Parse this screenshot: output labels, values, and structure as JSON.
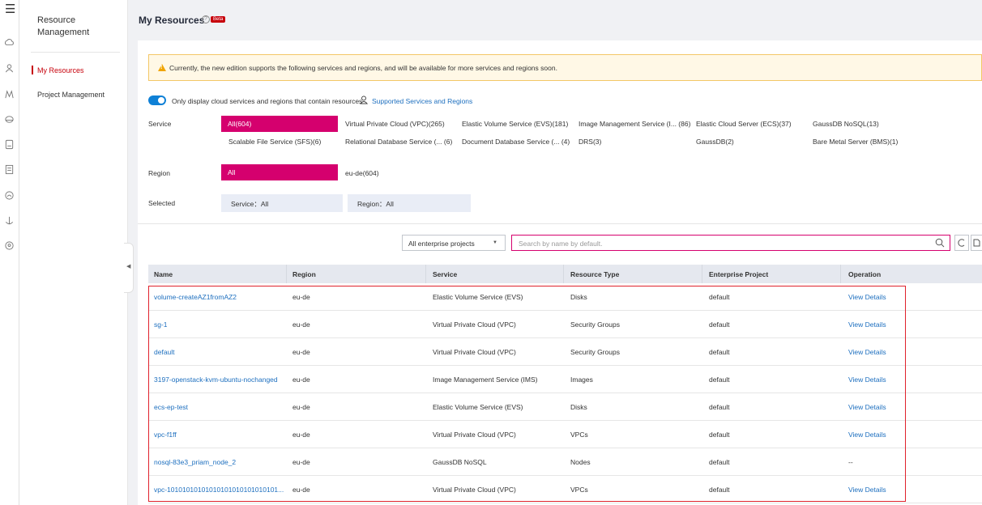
{
  "rail": {
    "icons": [
      "menu-icon",
      "cloud-icon",
      "user-group-icon",
      "network-icon",
      "database-icon",
      "storage-icon",
      "document-icon",
      "cloud-outline-icon",
      "anchor-icon",
      "pin-icon"
    ]
  },
  "sidebar": {
    "title": "Resource Management",
    "items": [
      {
        "label": "My Resources",
        "active": true
      },
      {
        "label": "Project Management",
        "active": false
      }
    ]
  },
  "header": {
    "title": "My Resources",
    "badge": "Beta"
  },
  "notice": {
    "text": "Currently, the new edition supports the following services and regions, and will be available for more services and regions soon."
  },
  "toggle": {
    "label": "Only display cloud services and regions that contain resources",
    "on": true,
    "link": "Supported Services and Regions"
  },
  "filters": {
    "service_label": "Service",
    "region_label": "Region",
    "selected_label": "Selected",
    "service_all": "All(604)",
    "service_row1": [
      "Virtual Private Cloud (VPC)(265)",
      "Elastic Volume Service (EVS)(181)",
      "Image Management Service (I... (86)",
      "Elastic Cloud Server (ECS)(37)",
      "GaussDB NoSQL(13)"
    ],
    "service_row2": [
      "Scalable File Service (SFS)(6)",
      "Relational Database Service (... (6)",
      "Document Database Service (... (4)",
      "DRS(3)",
      "GaussDB(2)",
      "Bare Metal Server (BMS)(1)"
    ],
    "region_all": "All",
    "region_options": [
      "eu-de(604)"
    ],
    "selected_service": "Service：All",
    "selected_region": "Region：All"
  },
  "toolbar": {
    "enterprise_select": "All enterprise projects",
    "search_placeholder": "Search by name by default."
  },
  "table": {
    "headers": [
      "Name",
      "Region",
      "Service",
      "Resource Type",
      "Enterprise Project",
      "Operation"
    ],
    "rows": [
      {
        "name": "volume-createAZ1fromAZ2",
        "region": "eu-de",
        "service": "Elastic Volume Service (EVS)",
        "type": "Disks",
        "project": "default",
        "op": "View Details"
      },
      {
        "name": "sg-1",
        "region": "eu-de",
        "service": "Virtual Private Cloud (VPC)",
        "type": "Security Groups",
        "project": "default",
        "op": "View Details"
      },
      {
        "name": "default",
        "region": "eu-de",
        "service": "Virtual Private Cloud (VPC)",
        "type": "Security Groups",
        "project": "default",
        "op": "View Details"
      },
      {
        "name": "3197-openstack-kvm-ubuntu-nochanged",
        "region": "eu-de",
        "service": "Image Management Service (IMS)",
        "type": "Images",
        "project": "default",
        "op": "View Details"
      },
      {
        "name": "ecs-ep-test",
        "region": "eu-de",
        "service": "Elastic Volume Service (EVS)",
        "type": "Disks",
        "project": "default",
        "op": "View Details"
      },
      {
        "name": "vpc-f1ff",
        "region": "eu-de",
        "service": "Virtual Private Cloud (VPC)",
        "type": "VPCs",
        "project": "default",
        "op": "View Details"
      },
      {
        "name": "nosql-83e3_priam_node_2",
        "region": "eu-de",
        "service": "GaussDB NoSQL",
        "type": "Nodes",
        "project": "default",
        "op": "--"
      },
      {
        "name": "vpc-10101010101010101010101010101...",
        "region": "eu-de",
        "service": "Virtual Private Cloud (VPC)",
        "type": "VPCs",
        "project": "default",
        "op": "View Details"
      }
    ]
  },
  "colors": {
    "accent": "#d5006e",
    "link": "#1d6fbf",
    "toggle": "#0e80d6",
    "highlight_box": "#e0222c"
  }
}
